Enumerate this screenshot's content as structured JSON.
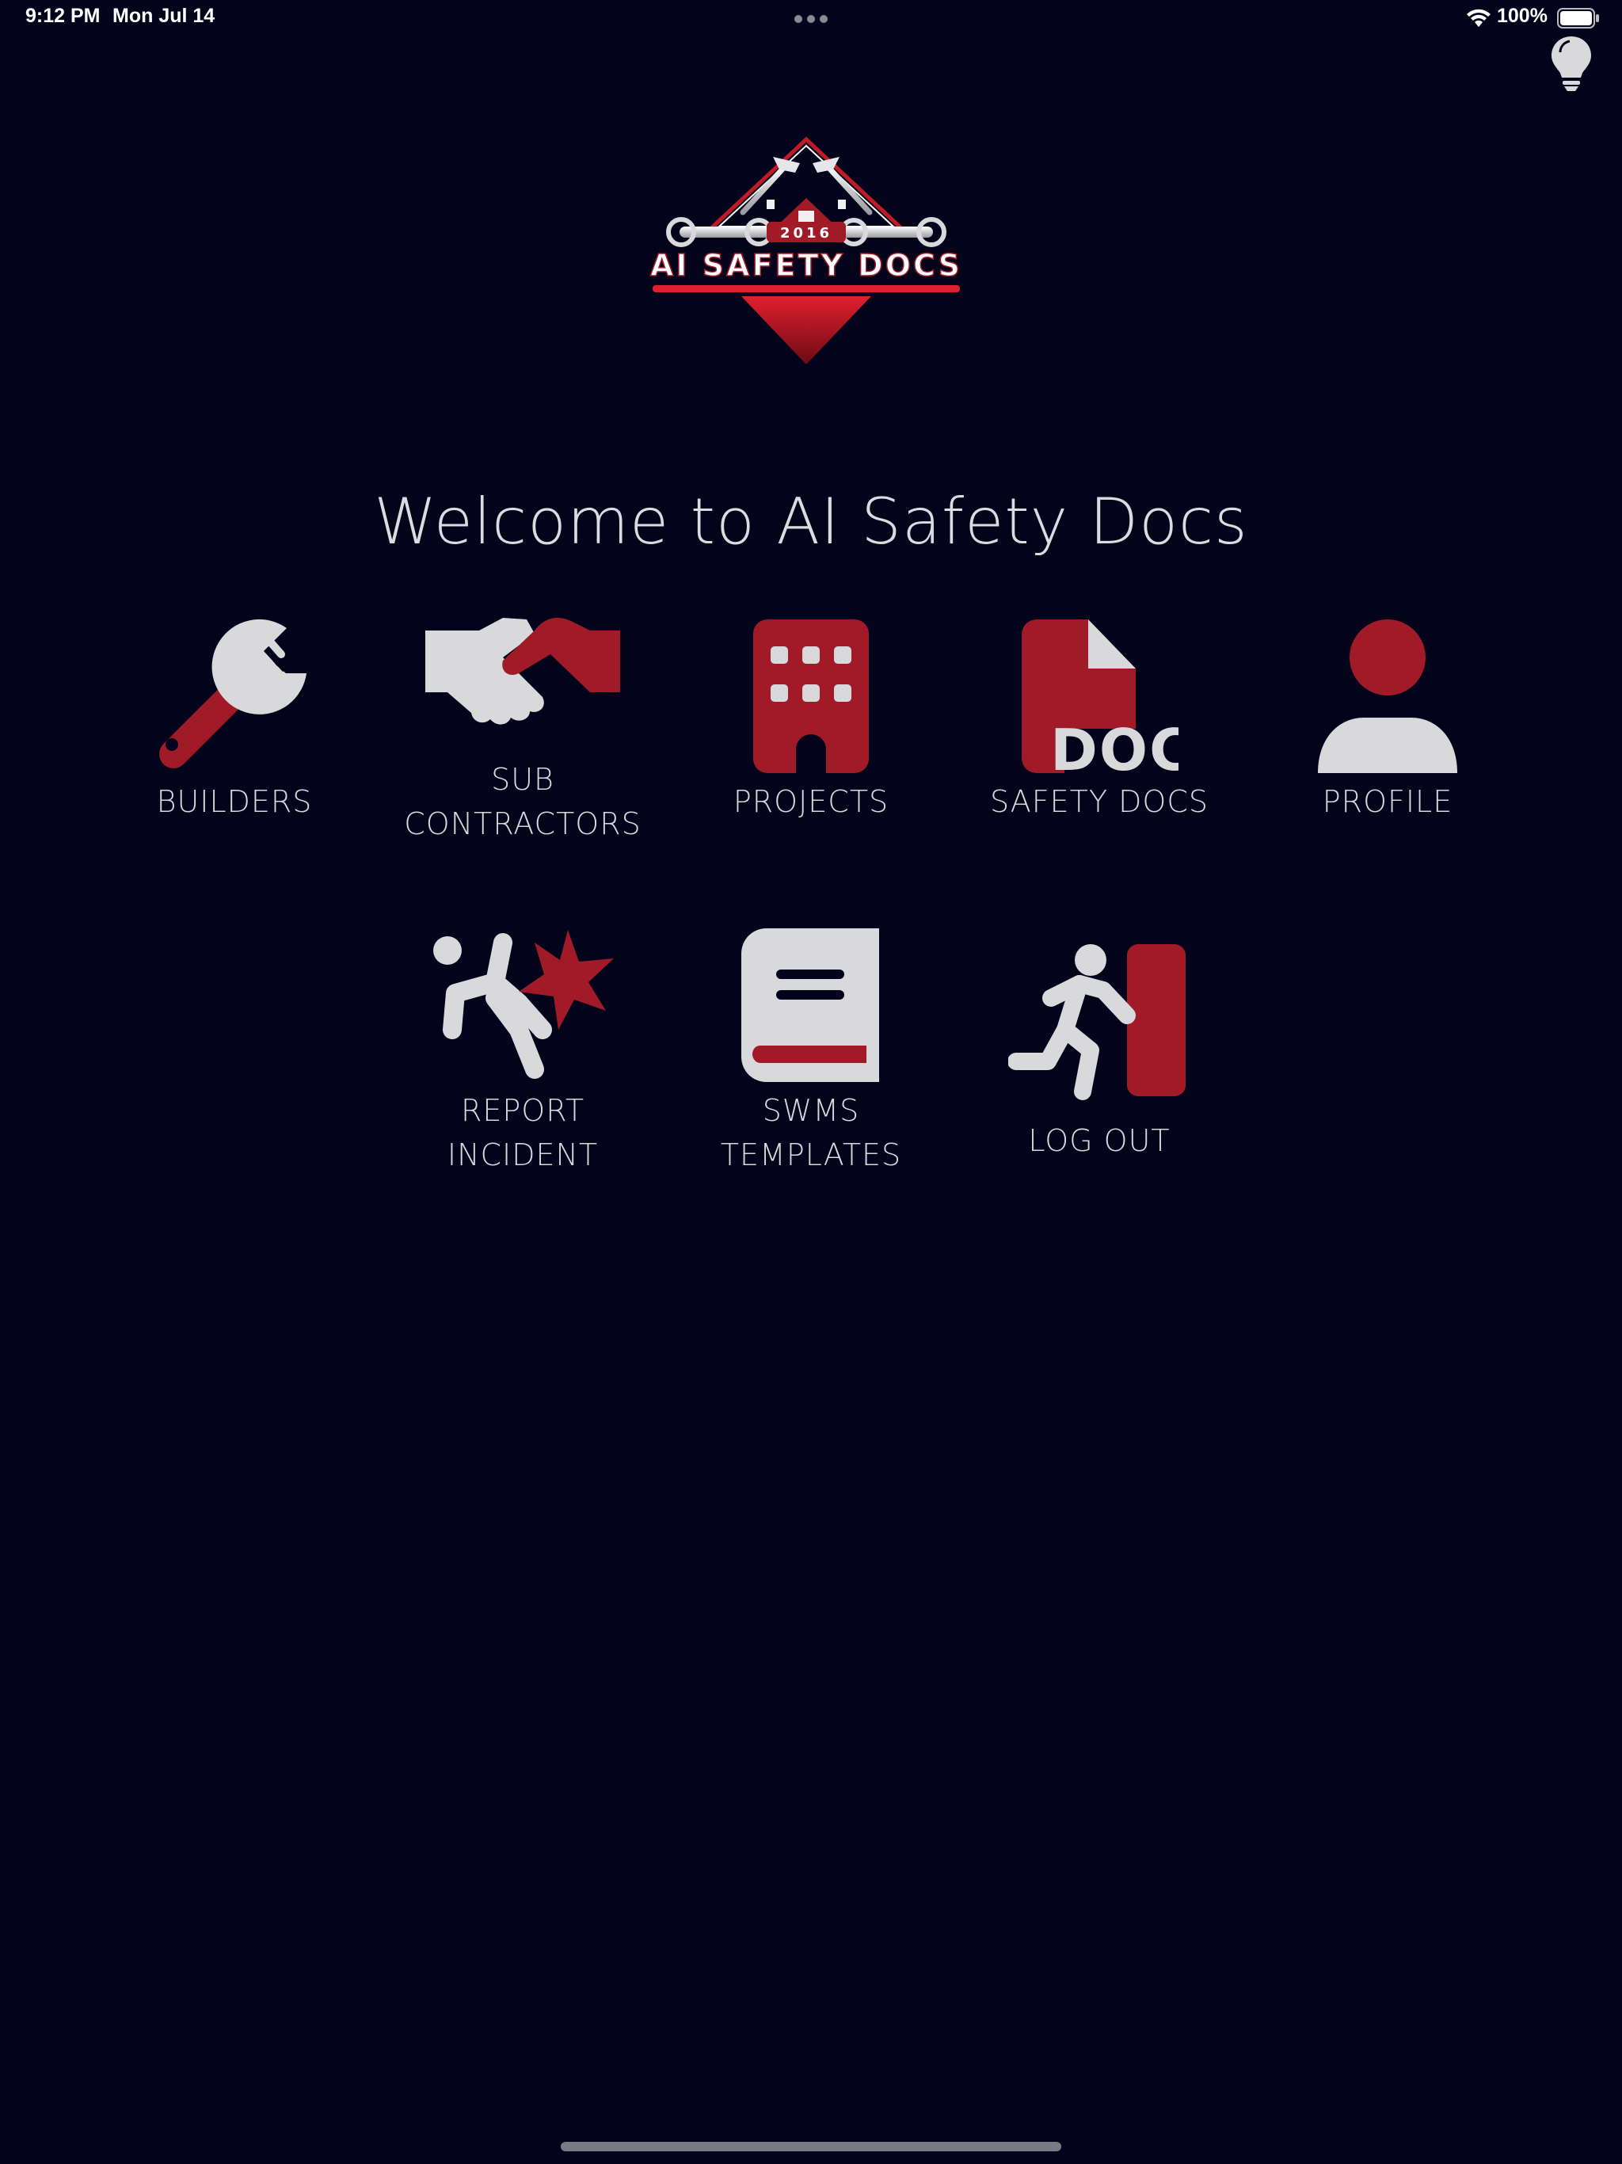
{
  "status_bar": {
    "time": "9:12 PM",
    "date": "Mon Jul 14",
    "battery": "100%",
    "icons": [
      "more-dots-icon",
      "wifi-icon",
      "battery-icon"
    ]
  },
  "header": {
    "help_icon": "lightbulb-icon"
  },
  "logo": {
    "year": "2016",
    "brand": "AI SAFETY DOCS"
  },
  "welcome_title": "Welcome to AI Safety Docs",
  "colors": {
    "background": "#03031c",
    "accent_red": "#a11a28",
    "icon_gray": "#d9d9dc"
  },
  "menu": {
    "builders": {
      "label": "BUILDERS",
      "icon": "wrench-icon"
    },
    "sub_contractors": {
      "label": "SUB\nCONTRACTORS",
      "icon": "handshake-icon"
    },
    "projects": {
      "label": "PROJECTS",
      "icon": "building-icon"
    },
    "safety_docs": {
      "label": "SAFETY DOCS",
      "icon": "doc-file-icon"
    },
    "profile": {
      "label": "PROFILE",
      "icon": "user-icon"
    },
    "report_incident": {
      "label": "REPORT\nINCIDENT",
      "icon": "person-falling-burst-icon"
    },
    "swms_templates": {
      "label": "SWMS\nTEMPLATES",
      "icon": "book-icon"
    },
    "log_out": {
      "label": "LOG OUT",
      "icon": "person-running-exit-icon"
    }
  }
}
